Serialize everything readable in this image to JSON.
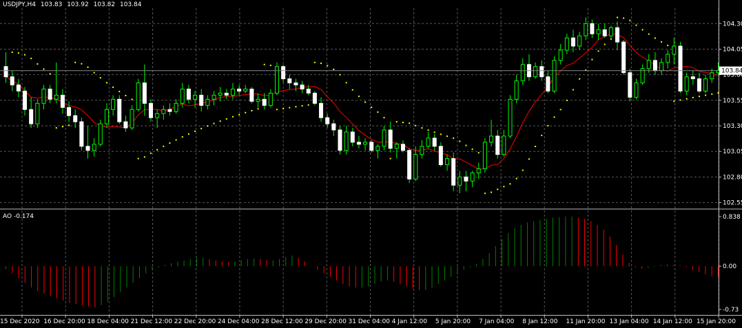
{
  "header": {
    "symbol": "USDJPY,H4",
    "open": "103.83",
    "high": "103.92",
    "low": "103.82",
    "close": "103.84"
  },
  "indicator": {
    "name": "AO",
    "value": "-0.174"
  },
  "colors": {
    "background": "#000000",
    "grid": "#5a5a5a",
    "bull_candle": "#ffffff",
    "bear_candle": "#ffffff",
    "wick": "#00ff00",
    "ma_line": "#ff0000",
    "sar_dots": "#ffff00",
    "ao_up": "#008000",
    "ao_down": "#ff0000",
    "price_marker_bg": "#ffffff",
    "price_marker_text": "#000000"
  },
  "chart_data": [
    {
      "type": "candlestick",
      "title": "USDJPY,H4",
      "price_axis_ticks": [
        "104.30",
        "104.05",
        "103.80",
        "103.55",
        "103.30",
        "103.05",
        "102.80",
        "102.55"
      ],
      "current_price": "103.84",
      "ylim": [
        102.5,
        104.45
      ],
      "time_axis_labels": [
        "15 Dec 2020",
        "16 Dec 20:00",
        "18 Dec 04:00",
        "21 Dec 12:00",
        "22 Dec 20:00",
        "24 Dec 04:00",
        "28 Dec 12:00",
        "29 Dec 20:00",
        "31 Dec 04:00",
        "4 Jan 12:00",
        "5 Jan 20:00",
        "7 Jan 04:00",
        "8 Jan 12:00",
        "11 Jan 20:00",
        "13 Jan 04:00",
        "14 Jan 12:00",
        "15 Jan 20:00"
      ],
      "candles": [
        {
          "o": 103.88,
          "h": 104.02,
          "l": 103.72,
          "c": 103.78
        },
        {
          "o": 103.78,
          "h": 103.84,
          "l": 103.64,
          "c": 103.7
        },
        {
          "o": 103.7,
          "h": 103.76,
          "l": 103.58,
          "c": 103.64
        },
        {
          "o": 103.64,
          "h": 103.68,
          "l": 103.4,
          "c": 103.46
        },
        {
          "o": 103.46,
          "h": 103.58,
          "l": 103.28,
          "c": 103.32
        },
        {
          "o": 103.32,
          "h": 103.56,
          "l": 103.28,
          "c": 103.52
        },
        {
          "o": 103.52,
          "h": 103.7,
          "l": 103.46,
          "c": 103.66
        },
        {
          "o": 103.66,
          "h": 103.7,
          "l": 103.52,
          "c": 103.56
        },
        {
          "o": 103.56,
          "h": 103.92,
          "l": 103.52,
          "c": 103.6
        },
        {
          "o": 103.6,
          "h": 103.66,
          "l": 103.42,
          "c": 103.48
        },
        {
          "o": 103.48,
          "h": 103.54,
          "l": 103.34,
          "c": 103.4
        },
        {
          "o": 103.4,
          "h": 103.46,
          "l": 103.28,
          "c": 103.34
        },
        {
          "o": 103.34,
          "h": 103.38,
          "l": 103.06,
          "c": 103.1
        },
        {
          "o": 103.1,
          "h": 103.3,
          "l": 102.98,
          "c": 103.06
        },
        {
          "o": 103.06,
          "h": 103.18,
          "l": 103.0,
          "c": 103.12
        },
        {
          "o": 103.12,
          "h": 103.36,
          "l": 103.1,
          "c": 103.32
        },
        {
          "o": 103.32,
          "h": 103.52,
          "l": 103.28,
          "c": 103.46
        },
        {
          "o": 103.46,
          "h": 103.6,
          "l": 103.4,
          "c": 103.56
        },
        {
          "o": 103.56,
          "h": 103.6,
          "l": 103.32,
          "c": 103.34
        },
        {
          "o": 103.34,
          "h": 103.4,
          "l": 103.24,
          "c": 103.28
        },
        {
          "o": 103.28,
          "h": 103.5,
          "l": 103.26,
          "c": 103.46
        },
        {
          "o": 103.46,
          "h": 103.76,
          "l": 103.44,
          "c": 103.72
        },
        {
          "o": 103.72,
          "h": 103.9,
          "l": 103.4,
          "c": 103.52
        },
        {
          "o": 103.52,
          "h": 103.56,
          "l": 103.34,
          "c": 103.38
        },
        {
          "o": 103.38,
          "h": 103.46,
          "l": 103.28,
          "c": 103.42
        },
        {
          "o": 103.42,
          "h": 103.5,
          "l": 103.36,
          "c": 103.46
        },
        {
          "o": 103.46,
          "h": 103.52,
          "l": 103.4,
          "c": 103.44
        },
        {
          "o": 103.44,
          "h": 103.56,
          "l": 103.42,
          "c": 103.52
        },
        {
          "o": 103.52,
          "h": 103.72,
          "l": 103.48,
          "c": 103.66
        },
        {
          "o": 103.66,
          "h": 103.7,
          "l": 103.52,
          "c": 103.56
        },
        {
          "o": 103.56,
          "h": 103.64,
          "l": 103.48,
          "c": 103.6
        },
        {
          "o": 103.6,
          "h": 103.66,
          "l": 103.44,
          "c": 103.5
        },
        {
          "o": 103.5,
          "h": 103.6,
          "l": 103.46,
          "c": 103.56
        },
        {
          "o": 103.56,
          "h": 103.64,
          "l": 103.5,
          "c": 103.6
        },
        {
          "o": 103.6,
          "h": 103.68,
          "l": 103.54,
          "c": 103.62
        },
        {
          "o": 103.62,
          "h": 103.66,
          "l": 103.56,
          "c": 103.6
        },
        {
          "o": 103.6,
          "h": 103.72,
          "l": 103.56,
          "c": 103.66
        },
        {
          "o": 103.66,
          "h": 103.7,
          "l": 103.6,
          "c": 103.64
        },
        {
          "o": 103.64,
          "h": 103.7,
          "l": 103.62,
          "c": 103.66
        },
        {
          "o": 103.66,
          "h": 103.68,
          "l": 103.52,
          "c": 103.54
        },
        {
          "o": 103.54,
          "h": 103.62,
          "l": 103.48,
          "c": 103.56
        },
        {
          "o": 103.56,
          "h": 103.62,
          "l": 103.46,
          "c": 103.5
        },
        {
          "o": 103.5,
          "h": 103.66,
          "l": 103.48,
          "c": 103.62
        },
        {
          "o": 103.62,
          "h": 103.92,
          "l": 103.6,
          "c": 103.88
        },
        {
          "o": 103.88,
          "h": 103.9,
          "l": 103.72,
          "c": 103.76
        },
        {
          "o": 103.76,
          "h": 103.8,
          "l": 103.66,
          "c": 103.72
        },
        {
          "o": 103.72,
          "h": 103.76,
          "l": 103.64,
          "c": 103.7
        },
        {
          "o": 103.7,
          "h": 103.74,
          "l": 103.62,
          "c": 103.66
        },
        {
          "o": 103.66,
          "h": 103.7,
          "l": 103.6,
          "c": 103.62
        },
        {
          "o": 103.62,
          "h": 103.64,
          "l": 103.5,
          "c": 103.52
        },
        {
          "o": 103.52,
          "h": 103.58,
          "l": 103.34,
          "c": 103.38
        },
        {
          "o": 103.38,
          "h": 103.42,
          "l": 103.28,
          "c": 103.32
        },
        {
          "o": 103.32,
          "h": 103.36,
          "l": 103.2,
          "c": 103.26
        },
        {
          "o": 103.26,
          "h": 103.3,
          "l": 103.02,
          "c": 103.06
        },
        {
          "o": 103.06,
          "h": 103.3,
          "l": 103.02,
          "c": 103.24
        },
        {
          "o": 103.24,
          "h": 103.28,
          "l": 103.1,
          "c": 103.14
        },
        {
          "o": 103.14,
          "h": 103.2,
          "l": 103.08,
          "c": 103.12
        },
        {
          "o": 103.12,
          "h": 103.18,
          "l": 103.06,
          "c": 103.14
        },
        {
          "o": 103.14,
          "h": 103.16,
          "l": 103.04,
          "c": 103.06
        },
        {
          "o": 103.06,
          "h": 103.12,
          "l": 102.98,
          "c": 103.1
        },
        {
          "o": 103.1,
          "h": 103.3,
          "l": 103.06,
          "c": 103.26
        },
        {
          "o": 103.26,
          "h": 103.34,
          "l": 103.04,
          "c": 103.08
        },
        {
          "o": 103.08,
          "h": 103.14,
          "l": 102.98,
          "c": 103.12
        },
        {
          "o": 103.12,
          "h": 103.16,
          "l": 103.04,
          "c": 103.06
        },
        {
          "o": 103.06,
          "h": 103.08,
          "l": 102.74,
          "c": 102.78
        },
        {
          "o": 102.78,
          "h": 103.1,
          "l": 102.76,
          "c": 103.02
        },
        {
          "o": 103.02,
          "h": 103.16,
          "l": 102.98,
          "c": 103.1
        },
        {
          "o": 103.1,
          "h": 103.24,
          "l": 103.08,
          "c": 103.18
        },
        {
          "o": 103.18,
          "h": 103.22,
          "l": 103.06,
          "c": 103.1
        },
        {
          "o": 103.1,
          "h": 103.14,
          "l": 102.9,
          "c": 102.92
        },
        {
          "o": 102.92,
          "h": 103.02,
          "l": 102.86,
          "c": 102.98
        },
        {
          "o": 102.98,
          "h": 103.04,
          "l": 102.66,
          "c": 102.72
        },
        {
          "o": 102.72,
          "h": 102.86,
          "l": 102.64,
          "c": 102.8
        },
        {
          "o": 102.8,
          "h": 102.86,
          "l": 102.66,
          "c": 102.76
        },
        {
          "o": 102.76,
          "h": 102.86,
          "l": 102.7,
          "c": 102.84
        },
        {
          "o": 102.84,
          "h": 102.94,
          "l": 102.78,
          "c": 102.88
        },
        {
          "o": 102.88,
          "h": 103.18,
          "l": 102.84,
          "c": 103.14
        },
        {
          "o": 103.14,
          "h": 103.36,
          "l": 103.1,
          "c": 103.2
        },
        {
          "o": 103.2,
          "h": 103.26,
          "l": 102.98,
          "c": 103.02
        },
        {
          "o": 103.02,
          "h": 103.26,
          "l": 103.0,
          "c": 103.2
        },
        {
          "o": 103.2,
          "h": 103.6,
          "l": 103.18,
          "c": 103.56
        },
        {
          "o": 103.56,
          "h": 103.8,
          "l": 103.52,
          "c": 103.74
        },
        {
          "o": 103.74,
          "h": 103.96,
          "l": 103.7,
          "c": 103.9
        },
        {
          "o": 103.9,
          "h": 104.0,
          "l": 103.74,
          "c": 103.78
        },
        {
          "o": 103.78,
          "h": 103.92,
          "l": 103.76,
          "c": 103.88
        },
        {
          "o": 103.88,
          "h": 103.94,
          "l": 103.74,
          "c": 103.78
        },
        {
          "o": 103.78,
          "h": 103.84,
          "l": 103.62,
          "c": 103.64
        },
        {
          "o": 103.64,
          "h": 103.98,
          "l": 103.62,
          "c": 103.94
        },
        {
          "o": 103.94,
          "h": 104.1,
          "l": 103.9,
          "c": 104.04
        },
        {
          "o": 104.04,
          "h": 104.2,
          "l": 104.0,
          "c": 104.16
        },
        {
          "o": 104.16,
          "h": 104.24,
          "l": 104.02,
          "c": 104.08
        },
        {
          "o": 104.08,
          "h": 104.22,
          "l": 104.04,
          "c": 104.18
        },
        {
          "o": 104.18,
          "h": 104.36,
          "l": 104.14,
          "c": 104.3
        },
        {
          "o": 104.3,
          "h": 104.34,
          "l": 104.16,
          "c": 104.2
        },
        {
          "o": 104.2,
          "h": 104.3,
          "l": 104.14,
          "c": 104.24
        },
        {
          "o": 104.24,
          "h": 104.3,
          "l": 104.16,
          "c": 104.18
        },
        {
          "o": 104.18,
          "h": 104.28,
          "l": 104.16,
          "c": 104.26
        },
        {
          "o": 104.26,
          "h": 104.32,
          "l": 104.04,
          "c": 104.12
        },
        {
          "o": 104.12,
          "h": 104.14,
          "l": 103.8,
          "c": 103.82
        },
        {
          "o": 103.82,
          "h": 103.86,
          "l": 103.54,
          "c": 103.58
        },
        {
          "o": 103.58,
          "h": 103.76,
          "l": 103.56,
          "c": 103.72
        },
        {
          "o": 103.72,
          "h": 103.9,
          "l": 103.7,
          "c": 103.86
        },
        {
          "o": 103.86,
          "h": 104.0,
          "l": 103.82,
          "c": 103.94
        },
        {
          "o": 103.94,
          "h": 104.02,
          "l": 103.8,
          "c": 103.84
        },
        {
          "o": 103.84,
          "h": 103.96,
          "l": 103.8,
          "c": 103.92
        },
        {
          "o": 103.92,
          "h": 104.04,
          "l": 103.86,
          "c": 104.0
        },
        {
          "o": 104.0,
          "h": 104.16,
          "l": 103.9,
          "c": 104.08
        },
        {
          "o": 104.08,
          "h": 104.12,
          "l": 103.62,
          "c": 103.64
        },
        {
          "o": 103.64,
          "h": 103.82,
          "l": 103.6,
          "c": 103.78
        },
        {
          "o": 103.78,
          "h": 103.84,
          "l": 103.7,
          "c": 103.76
        },
        {
          "o": 103.76,
          "h": 103.82,
          "l": 103.62,
          "c": 103.64
        },
        {
          "o": 103.64,
          "h": 103.8,
          "l": 103.62,
          "c": 103.76
        },
        {
          "o": 103.76,
          "h": 103.86,
          "l": 103.72,
          "c": 103.82
        },
        {
          "o": 103.82,
          "h": 103.92,
          "l": 103.8,
          "c": 103.84
        }
      ]
    },
    {
      "type": "bar",
      "title": "AO",
      "value_label": "-0.174",
      "axis_ticks": [
        "0.838",
        "0.00",
        "-0.73"
      ],
      "ylim": [
        -0.73,
        0.838
      ],
      "values": [
        -0.05,
        -0.12,
        -0.2,
        -0.28,
        -0.36,
        -0.42,
        -0.46,
        -0.5,
        -0.54,
        -0.58,
        -0.62,
        -0.64,
        -0.66,
        -0.68,
        -0.7,
        -0.66,
        -0.6,
        -0.52,
        -0.44,
        -0.36,
        -0.28,
        -0.2,
        -0.12,
        -0.06,
        -0.02,
        0.02,
        0.05,
        0.08,
        0.1,
        0.12,
        0.14,
        0.14,
        0.12,
        0.1,
        0.08,
        0.07,
        0.08,
        0.1,
        0.12,
        0.13,
        0.12,
        0.1,
        0.1,
        0.12,
        0.16,
        0.18,
        0.14,
        0.08,
        0.0,
        -0.06,
        -0.12,
        -0.18,
        -0.24,
        -0.3,
        -0.34,
        -0.36,
        -0.36,
        -0.34,
        -0.3,
        -0.26,
        -0.24,
        -0.26,
        -0.3,
        -0.34,
        -0.38,
        -0.4,
        -0.4,
        -0.36,
        -0.3,
        -0.24,
        -0.18,
        -0.12,
        -0.06,
        -0.02,
        0.04,
        0.12,
        0.22,
        0.34,
        0.46,
        0.56,
        0.64,
        0.7,
        0.74,
        0.76,
        0.78,
        0.8,
        0.82,
        0.83,
        0.84,
        0.84,
        0.82,
        0.8,
        0.76,
        0.7,
        0.62,
        0.5,
        0.36,
        0.2,
        0.06,
        -0.02,
        -0.04,
        -0.03,
        -0.01,
        0.02,
        0.03,
        0.02,
        0.01,
        -0.02,
        -0.06,
        -0.1,
        -0.14,
        -0.17,
        -0.174
      ]
    }
  ]
}
